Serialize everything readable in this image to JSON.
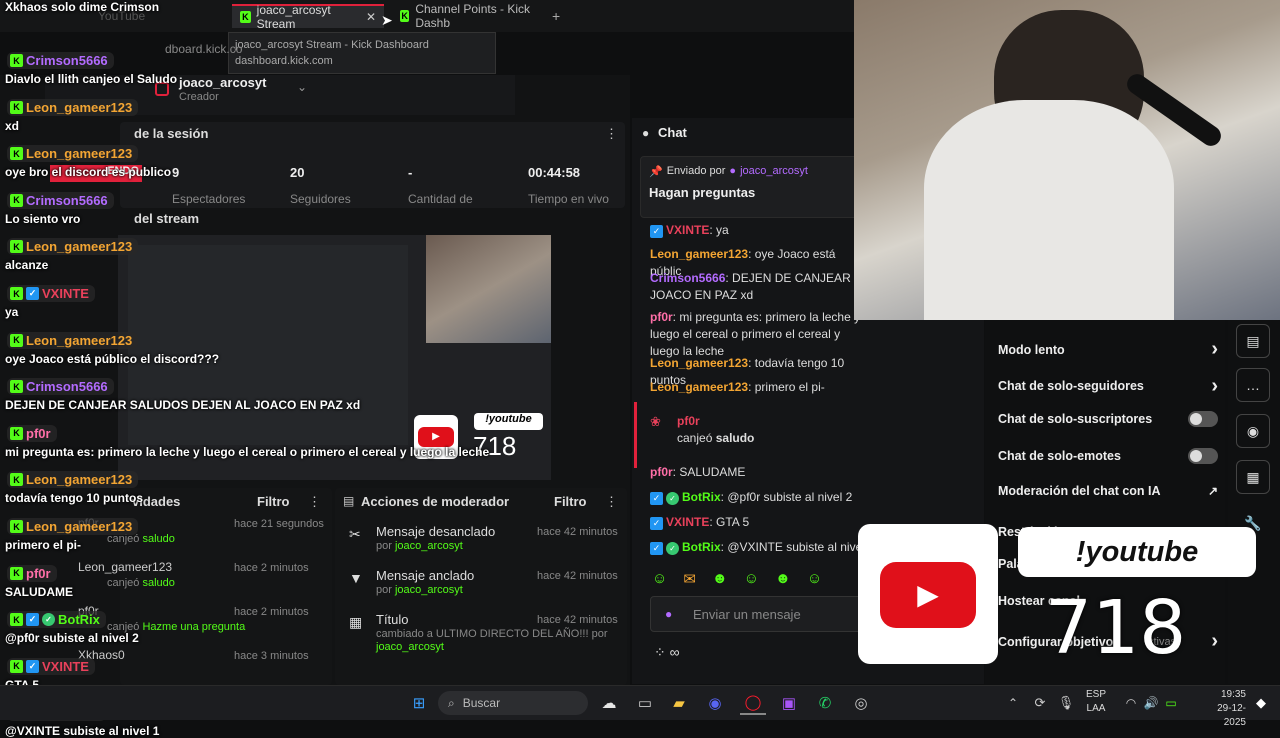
{
  "browser": {
    "tabs": [
      "joaco_arcosyt Stream",
      "Channel Points - Kick Dashb"
    ],
    "tab_bg": "YouTube",
    "tooltip_title": "joaco_arcosyt Stream - Kick Dashboard",
    "tooltip_url": "dashboard.kick.com",
    "partial_url": "dboard.kick.co"
  },
  "dashboard": {
    "username": "joaco_arcosyt",
    "role": "Creador",
    "session_title": "de la sesión",
    "live_badge": "ENDO",
    "stats": [
      "9",
      "20",
      "-",
      "00:44:58"
    ],
    "stat_labels": [
      "Espectadores",
      "Seguidores",
      "Cantidad de",
      "Tiempo en vivo"
    ],
    "stream_title": "del stream",
    "activity_title": "vidades",
    "activity_filter": "Filtro",
    "activity": [
      {
        "name": "pf0r",
        "action": "canjeó",
        "item": "saludo",
        "time": "hace 21 segundos"
      },
      {
        "name": "Leon_gameer123",
        "action": "canjeó",
        "item": "saludo",
        "time": "hace 2 minutos"
      },
      {
        "name": "pf0r",
        "action": "canjeó",
        "item": "Hazme una pregunta",
        "time": "hace 2 minutos"
      },
      {
        "name": "Xkhaos0",
        "action": "",
        "item": "",
        "time": "hace 3 minutos"
      }
    ],
    "mod_title": "Acciones de moderador",
    "mod_filter": "Filtro",
    "mod_actions": [
      {
        "title": "Mensaje desanclado",
        "by": "por",
        "user": "joaco_arcosyt",
        "time": "hace 42 minutos"
      },
      {
        "title": "Mensaje anclado",
        "by": "por",
        "user": "joaco_arcosyt",
        "time": "hace 42 minutos"
      },
      {
        "title": "Título",
        "by": "cambiado a ULTIMO DIRECTO DEL AÑO!!! por",
        "user": "joaco_arcosyt",
        "time": "hace 42 minutos"
      }
    ]
  },
  "overlay_chat": [
    {
      "name": "",
      "msg": "Xkhaos solo dime Crimson"
    },
    {
      "name": "Crimson5666",
      "msg": "Diavlo el llith canjeo el Saludo",
      "color": "#b36bff"
    },
    {
      "name": "Leon_gameer123",
      "msg": "xd",
      "color": "#f3a533"
    },
    {
      "name": "Leon_gameer123",
      "msg": "oye bro el discord es publico",
      "color": "#f3a533"
    },
    {
      "name": "Crimson5666",
      "msg": "Lo siento vro",
      "color": "#b36bff"
    },
    {
      "name": "Leon_gameer123",
      "msg": "alcanze",
      "color": "#f3a533"
    },
    {
      "name": "VXINTE",
      "msg": "ya",
      "color": "#e9415b"
    },
    {
      "name": "Leon_gameer123",
      "msg": "oye Joaco está público el discord???",
      "color": "#f3a533"
    },
    {
      "name": "Crimson5666",
      "msg": "DEJEN DE CANJEAR SALUDOS DEJEN AL JOACO EN PAZ xd",
      "color": "#b36bff"
    },
    {
      "name": "pf0r",
      "msg": "mi pregunta es: primero la leche y luego el cereal o primero el cereal y luego la leche",
      "color": "#ff6fa8"
    },
    {
      "name": "Leon_gameer123",
      "msg": "todavía tengo 10 puntos",
      "color": "#f3a533"
    },
    {
      "name": "Leon_gameer123",
      "msg": "primero el pi-",
      "color": "#f3a533"
    },
    {
      "name": "pf0r",
      "msg": "SALUDAME",
      "color": "#ff6fa8"
    },
    {
      "name": "BotRix",
      "msg": "@pf0r subiste al nivel 2",
      "color": "#53fc18"
    },
    {
      "name": "VXINTE",
      "msg": "GTA 5",
      "color": "#e9415b"
    },
    {
      "name": "BotRix",
      "msg": "@VXINTE subiste al nivel 1",
      "color": "#53fc18"
    }
  ],
  "chat": {
    "title": "Chat",
    "pinned_label": "Enviado por",
    "pinned_user": "joaco_arcosyt",
    "pinned_msg": "Hagan preguntas",
    "messages": [
      {
        "user": "VXINTE",
        "text": ": ya"
      },
      {
        "user": "Leon_gameer123",
        "text": ": oye Joaco está públic"
      },
      {
        "user": "Crimson5666",
        "text": ": DEJEN DE CANJEAR SA JOACO EN PAZ xd"
      },
      {
        "user": "pf0r",
        "text": ": mi pregunta es: primero la leche y luego el cereal o primero el cereal y luego la leche"
      },
      {
        "user": "Leon_gameer123",
        "text": ": todavía tengo 10 puntos"
      },
      {
        "user": "Leon_gameer123",
        "text": ": primero el pi-"
      }
    ],
    "redeem_user": "pf0r",
    "redeem_text": "canjeó",
    "redeem_item": "saludo",
    "after": [
      {
        "user": "pf0r",
        "text": ": SALUDAME"
      },
      {
        "user": "BotRix",
        "text": ": @pf0r subiste al nivel 2"
      },
      {
        "user": "VXINTE",
        "text": ": GTA 5"
      },
      {
        "user": "BotRix",
        "text": ": @VXINTE subiste al nivel"
      }
    ],
    "input_placeholder": "Enviar un mensaje"
  },
  "modmenu": {
    "items": [
      "Modo lento",
      "Chat de solo-seguidores",
      "Chat de solo-suscriptores",
      "Chat de solo-emotes",
      "Moderación del chat con IA",
      "Restricción",
      "Pala",
      "Hostear canal",
      "Configurar objetivo"
    ],
    "suffix": "ctivas"
  },
  "overlay": {
    "command": "!youtube",
    "count": "718"
  },
  "taskbar": {
    "search": "Buscar",
    "lang1": "ESP",
    "lang2": "LAA",
    "time": "19:35",
    "date": "29-12-2025"
  }
}
